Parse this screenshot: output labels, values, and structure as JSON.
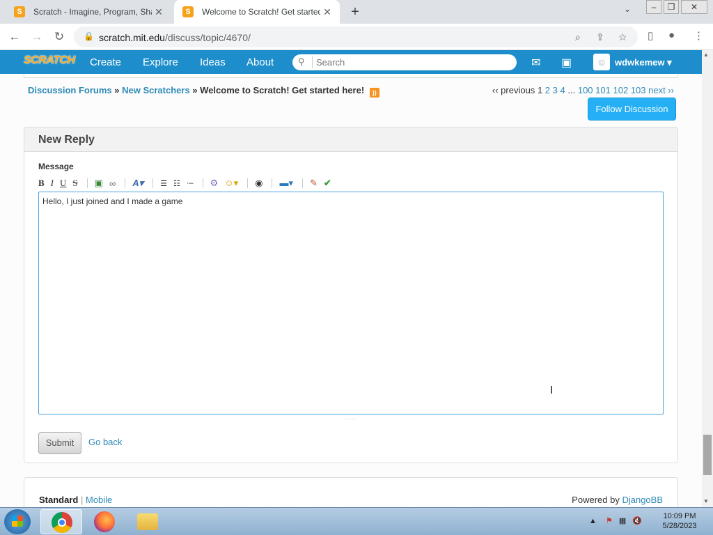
{
  "browser": {
    "tabs": [
      {
        "title": "Scratch - Imagine, Program, Shar",
        "active": false
      },
      {
        "title": "Welcome to Scratch! Get started",
        "active": true
      }
    ],
    "url_host": "scratch.mit.edu",
    "url_path": "/discuss/topic/4670/"
  },
  "nav": {
    "logo": "SCRATCH",
    "links": [
      "Create",
      "Explore",
      "Ideas",
      "About"
    ],
    "search_placeholder": "Search",
    "username": "wdwkemew"
  },
  "breadcrumb": {
    "forums": "Discussion Forums",
    "sep1": "»",
    "category": "New Scratchers",
    "sep2": "»",
    "topic": "Welcome to Scratch! Get started here!"
  },
  "pager": {
    "previous": "‹‹ previous",
    "current": "1",
    "pages": [
      "2",
      "3",
      "4"
    ],
    "ellipsis": "...",
    "last_pages": [
      "100",
      "101",
      "102",
      "103"
    ],
    "next": "next ››"
  },
  "follow_label": "Follow Discussion",
  "reply": {
    "header": "New Reply",
    "message_label": "Message",
    "text": "Hello, I just joined and I made a game",
    "submit_label": "Submit",
    "goback_label": "Go back"
  },
  "toolbar_icons": [
    "bold-icon",
    "italic-icon",
    "underline-icon",
    "strikethrough-icon",
    "image-icon",
    "link-icon",
    "font-color-icon",
    "bulleted-list-icon",
    "numbered-list-icon",
    "list-item-icon",
    "scratchblocks-icon",
    "smiley-icon",
    "globe-icon",
    "code-icon",
    "clean-icon",
    "preview-icon"
  ],
  "footer": {
    "standard": "Standard",
    "separator": "|",
    "mobile": "Mobile",
    "powered_by": "Powered by",
    "djangobb": "DjangoBB"
  },
  "taskbar": {
    "time": "10:09 PM",
    "date": "5/28/2023"
  },
  "colors": {
    "scratch_blue": "#1d8ecb",
    "link_blue": "#2d8ab8",
    "follow_button": "#25aff4"
  }
}
